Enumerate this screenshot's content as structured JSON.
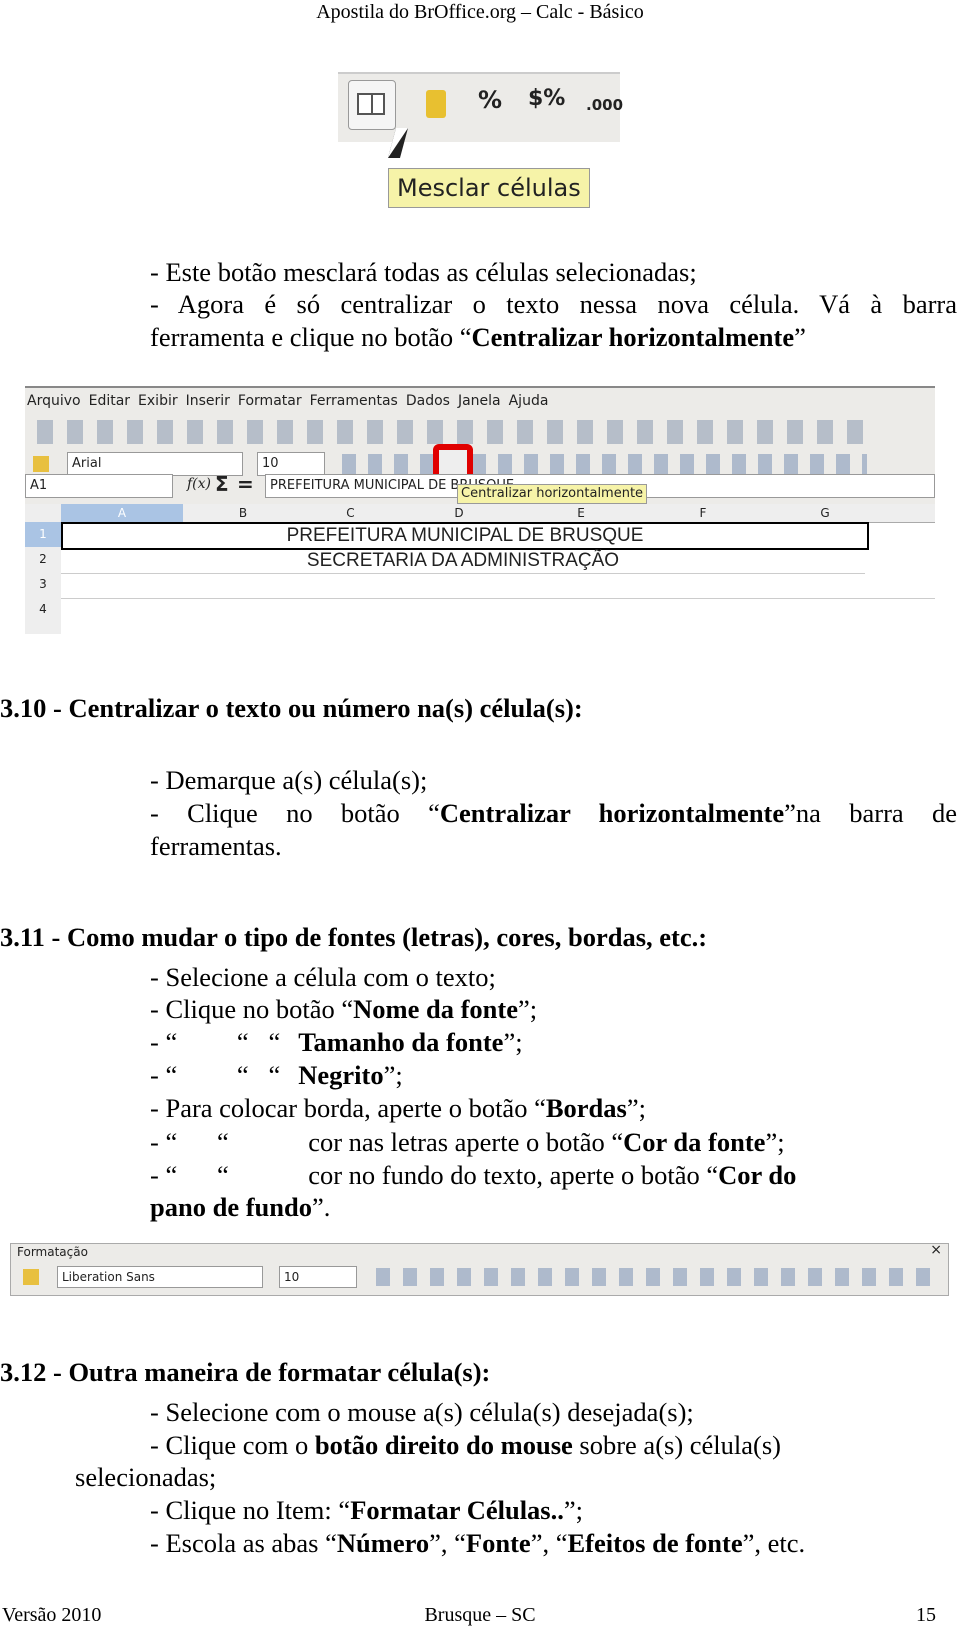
{
  "header": "Apostila do BrOffice.org – Calc - Básico",
  "image1": {
    "icons": [
      "merge-cells-icon",
      "currency-icon",
      "percent-icon",
      "currency-percent-icon",
      "decimal-icon"
    ],
    "tooltip": "Mesclar células",
    "labels": [
      "%",
      "$%",
      ".000"
    ]
  },
  "intro": {
    "l1": "- Este botão mesclará todas as células selecionadas;",
    "l2": "- Agora é só centralizar o texto nessa nova célula. Vá à barra",
    "l3a": "ferramenta e clique no botão “",
    "l3b": "Centralizar horizontalmente",
    "l3c": "”"
  },
  "image2": {
    "menu": [
      "Arquivo",
      "Editar",
      "Exibir",
      "Inserir",
      "Formatar",
      "Ferramentas",
      "Dados",
      "Janela",
      "Ajuda"
    ],
    "font": "Arial",
    "size": "10",
    "cell_ref": "A1",
    "fx": "f(x)",
    "sigma": "Σ",
    "equals": "=",
    "formula": "PREFEITURA MUNICIPAL DE BRUSQUE",
    "tooltip": "Centralizar horizontalmente",
    "columns": [
      "A",
      "B",
      "C",
      "D",
      "E",
      "F",
      "G"
    ],
    "rows": [
      "1",
      "2",
      "3",
      "4"
    ],
    "cells": [
      "PREFEITURA MUNICIPAL DE BRUSQUE",
      "SECRETARIA DA ADMINISTRAÇÃO"
    ],
    "highlight_color": "#e00000"
  },
  "s310": {
    "heading": "3.10 - Centralizar o texto ou número na(s) célula(s):",
    "l1": "- Demarque a(s) célula(s);",
    "l2a": "- Clique no botão “",
    "l2b": "Centralizar horizontalmente",
    "l2c": "”na barra de",
    "l3": "ferramentas."
  },
  "s311": {
    "heading": "3.11 - Como mudar o tipo de fontes (letras), cores, bordas, etc.:",
    "l1": "- Selecione a célula com o texto;",
    "l2a": "- Clique no botão “",
    "l2b": "Nome da fonte",
    "l2c": "”;",
    "l3a": "- “         “   “",
    "l3b": "Tamanho da fonte",
    "l3c": "”;",
    "l4a": "- “         “   “",
    "l4b": "Negrito",
    "l4c": "”;",
    "l5a": "- Para colocar borda, aperte o botão “",
    "l5b": "Bordas",
    "l5c": "”;",
    "l6a": "- “      “            cor nas letras aperte o botão “",
    "l6b": "Cor da fonte",
    "l6c": "”;",
    "l7a": "- “      “            cor no fundo do texto, aperte o botão “",
    "l7b": "Cor do",
    "l8a": "pano de fundo",
    "l8b": "”."
  },
  "image3": {
    "title": "Formatação",
    "font": "Liberation Sans",
    "size": "10",
    "close": "×"
  },
  "s312": {
    "heading": "3.12 - Outra maneira de formatar célula(s):",
    "l1": "- Selecione com o mouse a(s) célula(s) desejada(s);",
    "l2a": "- Clique com o ",
    "l2b": "botão direito do mouse",
    "l2c": " sobre a(s) célula(s)",
    "l3": "selecionadas;",
    "l4a": "- Clique no Item: “",
    "l4b": "Formatar Células..",
    "l4c": "”;",
    "l5a": "- Escola as abas “",
    "l5b": "Número",
    "l5c": "”, “",
    "l5d": "Fonte",
    "l5e": "”, “",
    "l5f": "Efeitos de fonte",
    "l5g": "”, etc."
  },
  "footer": {
    "left": "Versão 2010",
    "center": "Brusque – SC",
    "right": "15"
  }
}
